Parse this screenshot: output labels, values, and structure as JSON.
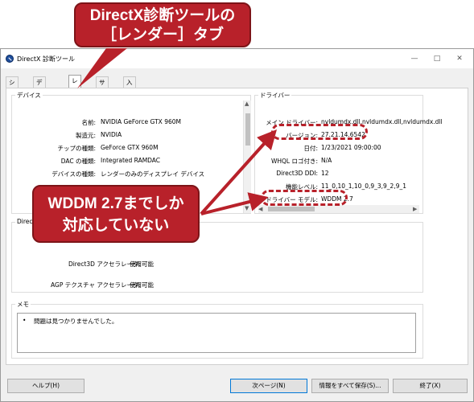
{
  "window": {
    "title": "DirectX 診断ツール",
    "minimize": "—",
    "maximize": "□",
    "close": "✕"
  },
  "tabs": [
    "システム",
    "ディスプレイ",
    "レンダー",
    "サウンド",
    "入力"
  ],
  "device": {
    "group_label": "デバイス",
    "rows": [
      {
        "label": "名前:",
        "value": "NVIDIA GeForce GTX 960M"
      },
      {
        "label": "製造元:",
        "value": "NVIDIA"
      },
      {
        "label": "チップの種類:",
        "value": "GeForce GTX 960M"
      },
      {
        "label": "DAC の種類:",
        "value": "Integrated RAMDAC"
      },
      {
        "label": "デバイスの種類:",
        "value": "レンダーのみのディスプレイ デバイス"
      }
    ]
  },
  "driver": {
    "group_label": "ドライバー",
    "rows": [
      {
        "label": "メイン ドライバー:",
        "value": "nvldumdx.dll,nvldumdx.dll,nvldumdx.dll"
      },
      {
        "label": "バージョン:",
        "value": "27.21.14.6542"
      },
      {
        "label": "日付:",
        "value": "1/23/2021 09:00:00"
      },
      {
        "label": "WHQL ロゴ付き:",
        "value": "N/A"
      },
      {
        "label": "Direct3D DDI:",
        "value": "12"
      },
      {
        "label": "機能レベル:",
        "value": "11_0,10_1,10_0,9_3,9_2,9_1"
      },
      {
        "label": "ドライバー モデル:",
        "value": "WDDM 2.7"
      }
    ]
  },
  "features": {
    "group_label": "Direct",
    "rows": [
      {
        "label": "Direct3D アクセラレータ:",
        "value": "使用可能"
      },
      {
        "label": "AGP テクスチャ アクセラレータ:",
        "value": "使用可能"
      }
    ]
  },
  "memo": {
    "group_label": "メモ",
    "bullet": "•",
    "text": "問題は見つかりませんでした。"
  },
  "buttons": {
    "help": "ヘルプ(H)",
    "next": "次ページ(N)",
    "save_all": "情報をすべて保存(S)...",
    "exit": "終了(X)"
  },
  "annotations": {
    "title_callout_line1": "DirectX診断ツールの",
    "title_callout_line2": "［レンダー］タブ",
    "wddm_callout_line1": "WDDM 2.7までしか",
    "wddm_callout_line2": "対応していない"
  },
  "colors": {
    "annotation": "#b8212a",
    "focus_border": "#0078d7"
  }
}
